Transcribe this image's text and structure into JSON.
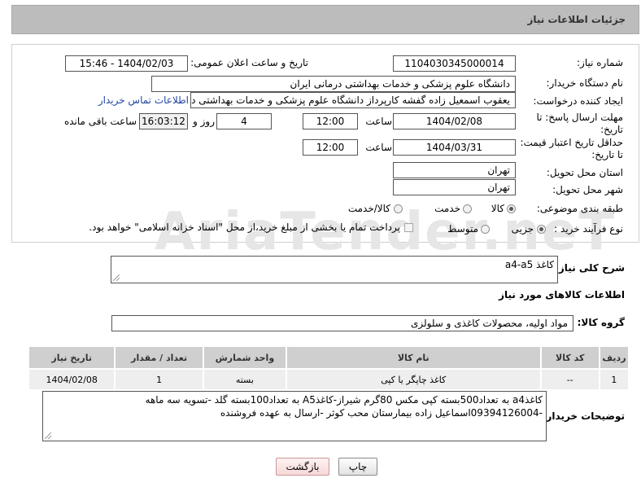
{
  "header": {
    "title": "جزئیات اطلاعات نیاز"
  },
  "form": {
    "need_number_label": "شماره نیاز:",
    "need_number": "1104030345000014",
    "announce_label": "تاریخ و ساعت اعلان عمومی:",
    "announce_value": "1404/02/03 - 15:46",
    "buyer_org_label": "نام دستگاه خریدار:",
    "buyer_org": "دانشگاه علوم پزشکی و خدمات بهداشتی درمانی ایران",
    "requester_label": "ایجاد کننده درخواست:",
    "requester": "یعقوب اسمعیل زاده گفشه کارپرداز دانشگاه علوم پزشکی و خدمات بهداشتی در",
    "contact_link": "اطلاعات تماس خریدار",
    "deadline_label_1": "مهلت ارسال پاسخ: تا",
    "deadline_label_2": "تاریخ:",
    "deadline_date": "1404/02/08",
    "time_label": "ساعت",
    "deadline_time": "12:00",
    "days_value": "4",
    "days_label": "روز و",
    "remaining_time": "16:03:12",
    "remaining_label": "ساعت باقی مانده",
    "min_price_label_1": "حداقل تاریخ اعتبار قیمت:",
    "min_price_label_2": "تا تاریخ:",
    "price_date": "1404/03/31",
    "price_time": "12:00",
    "province_label": "استان محل تحویل:",
    "province": "تهران",
    "city_label": "شهر محل تحویل:",
    "city": "تهران",
    "category_label": "طبقه بندی موضوعی:",
    "category_options": [
      "کالا",
      "خدمت",
      "کالا/خدمت"
    ],
    "category_selected": "کالا",
    "process_label": "نوع فرآیند خرید :",
    "process_options": [
      "جزیی",
      "متوسط"
    ],
    "process_selected": "جزیی",
    "payment_note": "پرداخت تمام یا بخشی از مبلغ خرید،از محل \"اسناد خزانه اسلامی\" خواهد بود."
  },
  "watermark": "AriaTender.neT",
  "summary": {
    "label": "شرح کلی نیاز:",
    "value": "کاغذ a4-a5"
  },
  "goods": {
    "section_title": "اطلاعات کالاهای مورد نیاز",
    "group_label": "گروه کالا:",
    "group_value": "مواد اولیه، محصولات کاغذی و سلولزی",
    "table": {
      "headers": [
        "ردیف",
        "کد کالا",
        "نام کالا",
        "واحد شمارش",
        "تعداد / مقدار",
        "تاریخ نیاز"
      ],
      "rows": [
        [
          "1",
          "--",
          "کاغذ چاپگر یا کپی",
          "بسته",
          "1",
          "1404/02/08"
        ]
      ]
    }
  },
  "buyer_notes": {
    "label": "توضیحات خریدار:",
    "line1": "کاغذa4 به تعداد500بسته کپی مکس 80گرم شیراز-کاغذA5 به تعداد100بسته گلد -تسویه سه ماهه",
    "line2": "-09394126004اسماعیل زاده بیمارستان محب کوثر -ارسال به عهده فروشنده"
  },
  "buttons": {
    "print": "چاپ",
    "back": "بازگشت"
  }
}
